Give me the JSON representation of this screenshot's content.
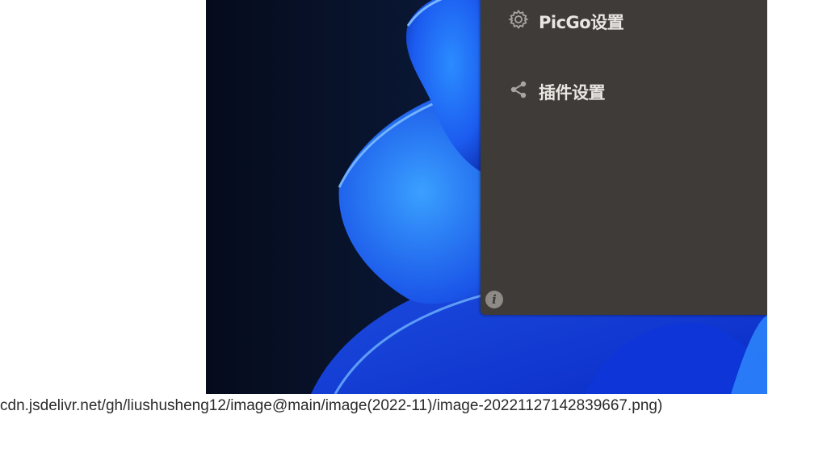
{
  "panel": {
    "items": [
      {
        "label": "PicGo设置",
        "icon": "gear-icon"
      },
      {
        "label": "插件设置",
        "icon": "share-icon"
      }
    ],
    "info_icon": "info-icon",
    "colors": {
      "panel_bg": "#3f3b38",
      "label": "#e9e6e1",
      "icon": "#a9a6a2"
    }
  },
  "caption": {
    "text": "cdn.jsdelivr.net/gh/liushusheng12/image@main/image(2022-11)/image-20221127142839667.png)"
  },
  "wallpaper": {
    "description_colors": {
      "dark": "#081024",
      "blue": "#1e63ff",
      "light": "#5fa8ff"
    }
  }
}
